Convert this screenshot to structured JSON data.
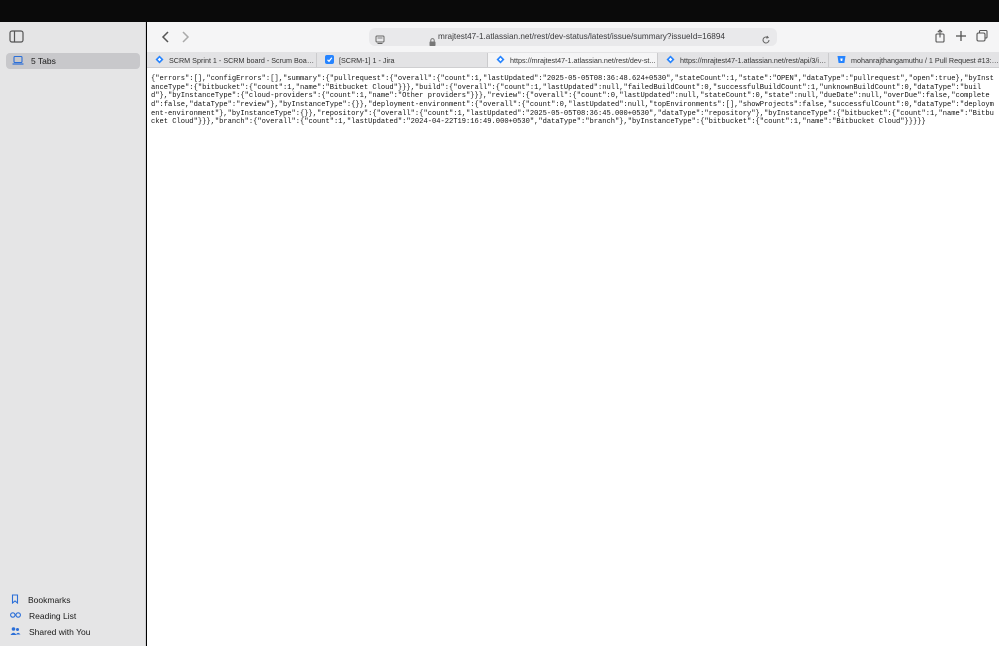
{
  "sidebar": {
    "tabs_label": "5 Tabs",
    "bookmarks_label": "Bookmarks",
    "reading_list_label": "Reading List",
    "shared_label": "Shared with You"
  },
  "address_bar": {
    "url": "mrajtest47-1.atlassian.net/rest/dev-status/latest/issue/summary?issueId=16894"
  },
  "tabs": [
    {
      "title": "SCRM Sprint 1 - SCRM board - Scrum Board...",
      "icon": "jira-icon",
      "active": false
    },
    {
      "title": "[SCRM-1] 1 - Jira",
      "icon": "jira-software-icon",
      "active": false
    },
    {
      "title": "https://mrajtest47-1.atlassian.net/rest/dev-st...",
      "icon": "jira-icon",
      "active": true
    },
    {
      "title": "https://mrajtest47-1.atlassian.net/rest/api/3/is...",
      "icon": "jira-icon",
      "active": false
    },
    {
      "title": "mohanrajthangamuthu / 1 Pull Request #13: S...",
      "icon": "bitbucket-icon",
      "active": false
    }
  ],
  "content": {
    "json_text": "{\"errors\":[],\"configErrors\":[],\"summary\":{\"pullrequest\":{\"overall\":{\"count\":1,\"lastUpdated\":\"2025-05-05T08:36:48.624+0530\",\"stateCount\":1,\"state\":\"OPEN\",\"dataType\":\"pullrequest\",\"open\":true},\"byInstanceType\":{\"bitbucket\":{\"count\":1,\"name\":\"Bitbucket Cloud\"}}},\"build\":{\"overall\":{\"count\":1,\"lastUpdated\":null,\"failedBuildCount\":0,\"successfulBuildCount\":1,\"unknownBuildCount\":0,\"dataType\":\"build\"},\"byInstanceType\":{\"cloud-providers\":{\"count\":1,\"name\":\"Other providers\"}}},\"review\":{\"overall\":{\"count\":0,\"lastUpdated\":null,\"stateCount\":0,\"state\":null,\"dueDate\":null,\"overDue\":false,\"completed\":false,\"dataType\":\"review\"},\"byInstanceType\":{}},\"deployment-environment\":{\"overall\":{\"count\":0,\"lastUpdated\":null,\"topEnvironments\":[],\"showProjects\":false,\"successfulCount\":0,\"dataType\":\"deployment-environment\"},\"byInstanceType\":{}},\"repository\":{\"overall\":{\"count\":1,\"lastUpdated\":\"2025-05-05T08:36:45.000+0530\",\"dataType\":\"repository\"},\"byInstanceType\":{\"bitbucket\":{\"count\":1,\"name\":\"Bitbucket Cloud\"}}},\"branch\":{\"overall\":{\"count\":1,\"lastUpdated\":\"2024-04-22T19:16:49.000+0530\",\"dataType\":\"branch\"},\"byInstanceType\":{\"bitbucket\":{\"count\":1,\"name\":\"Bitbucket Cloud\"}}}}}"
  }
}
